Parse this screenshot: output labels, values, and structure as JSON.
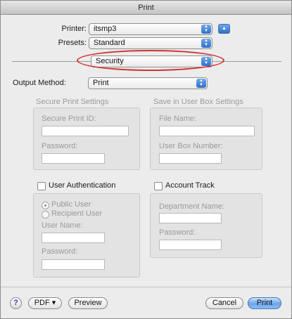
{
  "window": {
    "title": "Print"
  },
  "printer": {
    "label": "Printer:",
    "value": "itsmp3"
  },
  "presets": {
    "label": "Presets:",
    "value": "Standard"
  },
  "pane": {
    "value": "Security"
  },
  "output_method": {
    "label": "Output Method:",
    "value": "Print"
  },
  "secure_print": {
    "title": "Secure Print Settings",
    "id_label": "Secure Print ID:",
    "id_value": "",
    "password_label": "Password:",
    "password_value": ""
  },
  "user_box": {
    "title": "Save in User Box Settings",
    "file_label": "File Name:",
    "file_value": "",
    "number_label": "User Box Number:",
    "number_value": ""
  },
  "user_auth": {
    "label": "User Authentication",
    "checked": false,
    "public_user": "Public User",
    "recipient_user": "Recipient User",
    "username_label": "User Name:",
    "username_value": "",
    "password_label": "Password:",
    "password_value": ""
  },
  "account_track": {
    "label": "Account Track",
    "checked": false,
    "department_label": "Department Name:",
    "department_value": "",
    "password_label": "Password:",
    "password_value": ""
  },
  "buttons": {
    "help": "?",
    "pdf": "PDF ▾",
    "preview": "Preview",
    "cancel": "Cancel",
    "print": "Print"
  },
  "colors": {
    "accent": "#2f6fc9",
    "highlight_oval": "#d23030",
    "window_bg": "#ececec"
  },
  "icons": {
    "disclosure": "triangle-up-icon",
    "popup_arrows": "up-down-arrows-icon",
    "help": "question-mark-icon"
  }
}
